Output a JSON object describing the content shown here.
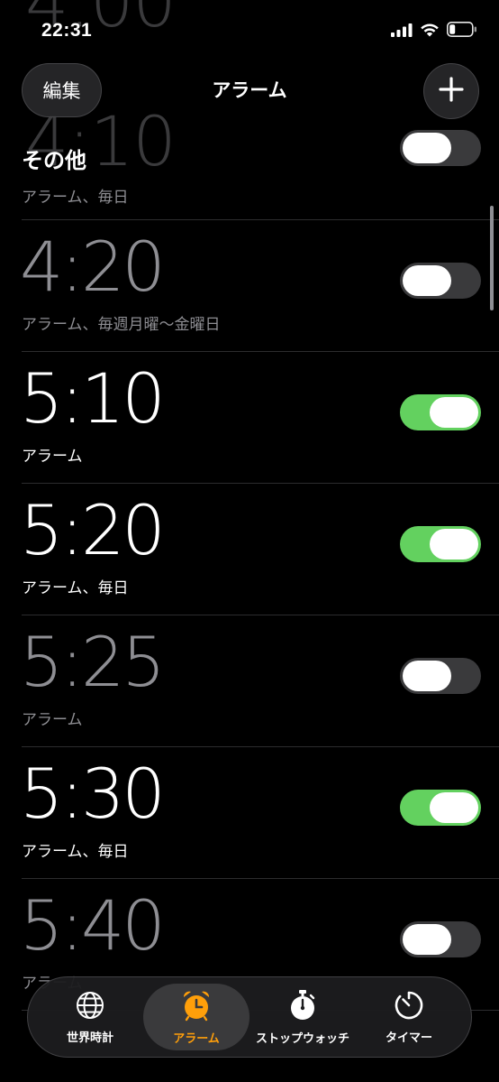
{
  "status_bar": {
    "time": "22:31"
  },
  "header": {
    "edit_label": "編集",
    "title": "アラーム",
    "add_icon": "plus-icon"
  },
  "section": {
    "title": "その他",
    "subtitle": "アラーム、毎日"
  },
  "alarms": [
    {
      "time": "4:20",
      "label": "アラーム、毎週月曜〜金曜日",
      "enabled": false
    },
    {
      "time": "5:10",
      "label": "アラーム",
      "enabled": true
    },
    {
      "time": "5:20",
      "label": "アラーム、毎日",
      "enabled": true
    },
    {
      "time": "5:25",
      "label": "アラーム",
      "enabled": false
    },
    {
      "time": "5:30",
      "label": "アラーム、毎日",
      "enabled": true
    },
    {
      "time": "5:40",
      "label": "アラーム",
      "enabled": false
    }
  ],
  "tabs": [
    {
      "label": "世界時計",
      "icon": "globe-icon",
      "active": false
    },
    {
      "label": "アラーム",
      "icon": "alarm-clock-icon",
      "active": true
    },
    {
      "label": "ストップウォッチ",
      "icon": "stopwatch-icon",
      "active": false
    },
    {
      "label": "タイマー",
      "icon": "timer-icon",
      "active": false
    }
  ],
  "colors": {
    "toggle_on": "#63d15f",
    "toggle_off": "#3a3a3c",
    "accent": "#ff9f0a",
    "secondary_text": "#8e8e93"
  }
}
